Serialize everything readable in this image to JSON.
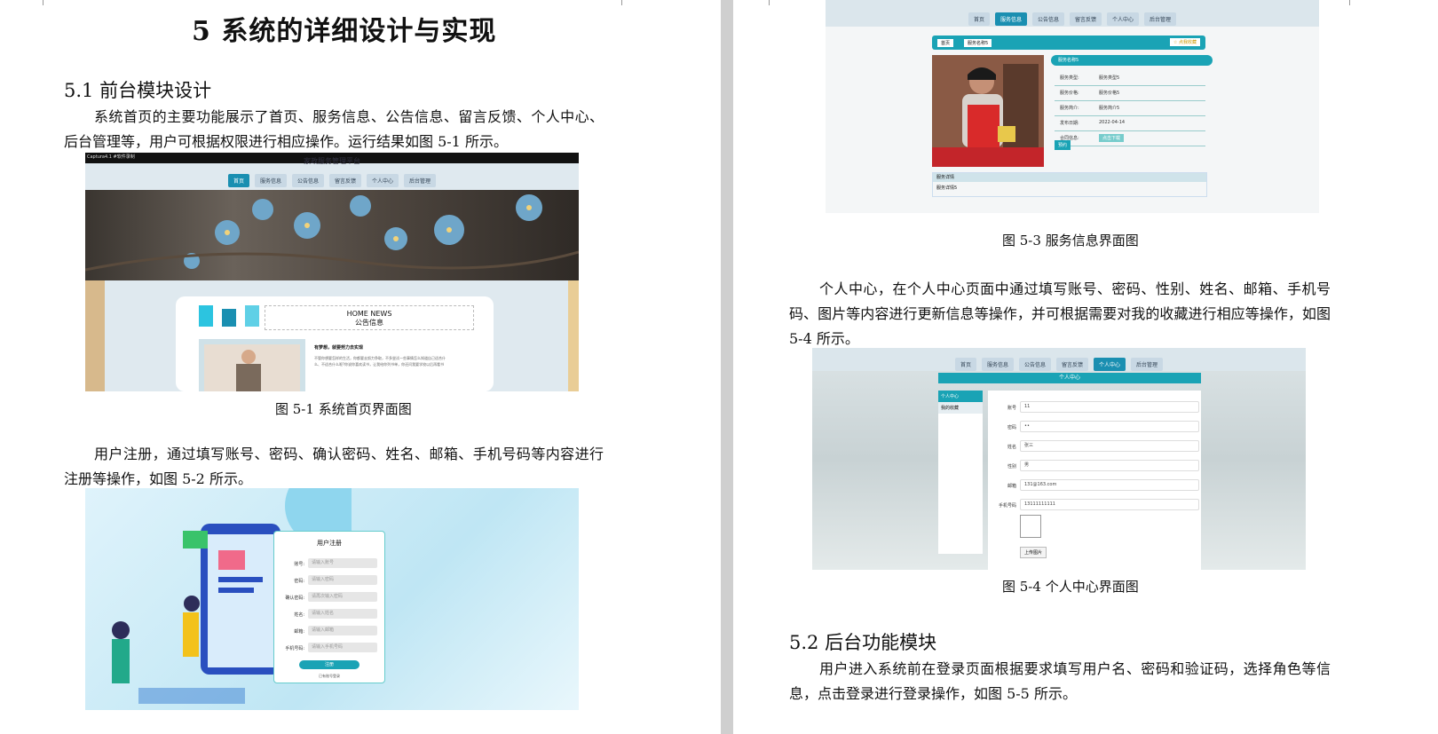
{
  "left_page": {
    "chapter_title": "5 系统的详细设计与实现",
    "section_title": "5.1 前台模块设计",
    "para1": "系统首页的主要功能展示了首页、服务信息、公告信息、留言反馈、个人中心、后台管理等，用户可根据权限进行相应操作。运行结果如图 5-1 所示。",
    "fig1": {
      "caption": "图 5-1  系统首页界面图",
      "recorder_label": "Captura4.1 #软件录制",
      "site_title": "家政服务管理平台",
      "nav": [
        "首页",
        "服务信息",
        "公告信息",
        "留言反馈",
        "个人中心",
        "后台管理"
      ],
      "news_heading": "HOME NEWS",
      "news_subheading": "公告信息",
      "news_item_title": "有梦想，就要努力去实现",
      "news_item_text": "不管你想要怎样的生活，你都要去努力争取，不多尝试一些事情怎么知道自己适合什么、不适合什么呢?你说你喜欢读书，让我给你列书单，你还问我要学校以后再看书"
    },
    "para2": "用户注册，通过填写账号、密码、确认密码、姓名、邮箱、手机号码等内容进行注册等操作，如图 5-2 所示。",
    "fig2": {
      "form_title": "用户注册",
      "fields": [
        {
          "label": "账号:",
          "placeholder": "请输入账号"
        },
        {
          "label": "密码:",
          "placeholder": "请输入密码"
        },
        {
          "label": "确认密码:",
          "placeholder": "请再次输入密码"
        },
        {
          "label": "姓名:",
          "placeholder": "请输入姓名"
        },
        {
          "label": "邮箱:",
          "placeholder": "请输入邮箱"
        },
        {
          "label": "手机号码:",
          "placeholder": "请输入手机号码"
        }
      ],
      "register_btn": "注册",
      "login_link": "已有账号登录"
    }
  },
  "right_page": {
    "fig3": {
      "caption": "图 5-3 服务信息界面图",
      "nav": [
        "首页",
        "服务信息",
        "公告信息",
        "留言反馈",
        "个人中心",
        "后台管理"
      ],
      "breadcrumb_home": "首页",
      "breadcrumb_item": "服务名称5",
      "collect_btn": "☆ 点我收藏",
      "service_name": "服务名称5",
      "rows": [
        {
          "k": "服务类型:",
          "v": "服务类型5"
        },
        {
          "k": "服务价格:",
          "v": "服务价格5"
        },
        {
          "k": "服务简介:",
          "v": "服务简介5"
        },
        {
          "k": "发布日期:",
          "v": "2022-04-14"
        },
        {
          "k": "合同信息:",
          "v": "点击下载"
        }
      ],
      "book_btn": "预约",
      "detail_tab": "服务详情",
      "detail_text": "服务详情5"
    },
    "para3": "个人中心，在个人中心页面中通过填写账号、密码、性别、姓名、邮箱、手机号码、图片等内容进行更新信息等操作，并可根据需要对我的收藏进行相应等操作，如图 5-4 所示。",
    "fig4": {
      "caption": "图 5-4 个人中心界面图",
      "nav": [
        "首页",
        "服务信息",
        "公告信息",
        "留言反馈",
        "个人中心",
        "后台管理"
      ],
      "panel_title": "个人中心",
      "side_items": [
        "个人中心",
        "我的收藏"
      ],
      "fields": [
        {
          "label": "账号",
          "value": "11"
        },
        {
          "label": "密码",
          "value": "••"
        },
        {
          "label": "姓名",
          "value": "张三"
        },
        {
          "label": "性别",
          "value": "男"
        },
        {
          "label": "邮箱",
          "value": "131@163.com"
        },
        {
          "label": "手机号码",
          "value": "13111111111"
        }
      ],
      "upload_btn": "上传图片"
    },
    "section_title": "5.2 后台功能模块",
    "para4": "用户进入系统前在登录页面根据要求填写用户名、密码和验证码，选择角色等信息，点击登录进行登录操作，如图 5-5 所示。"
  },
  "colors": {
    "accent": "#1a8fb1",
    "teal": "#1aa3b5",
    "nav_bg": "#c8d8e4"
  }
}
